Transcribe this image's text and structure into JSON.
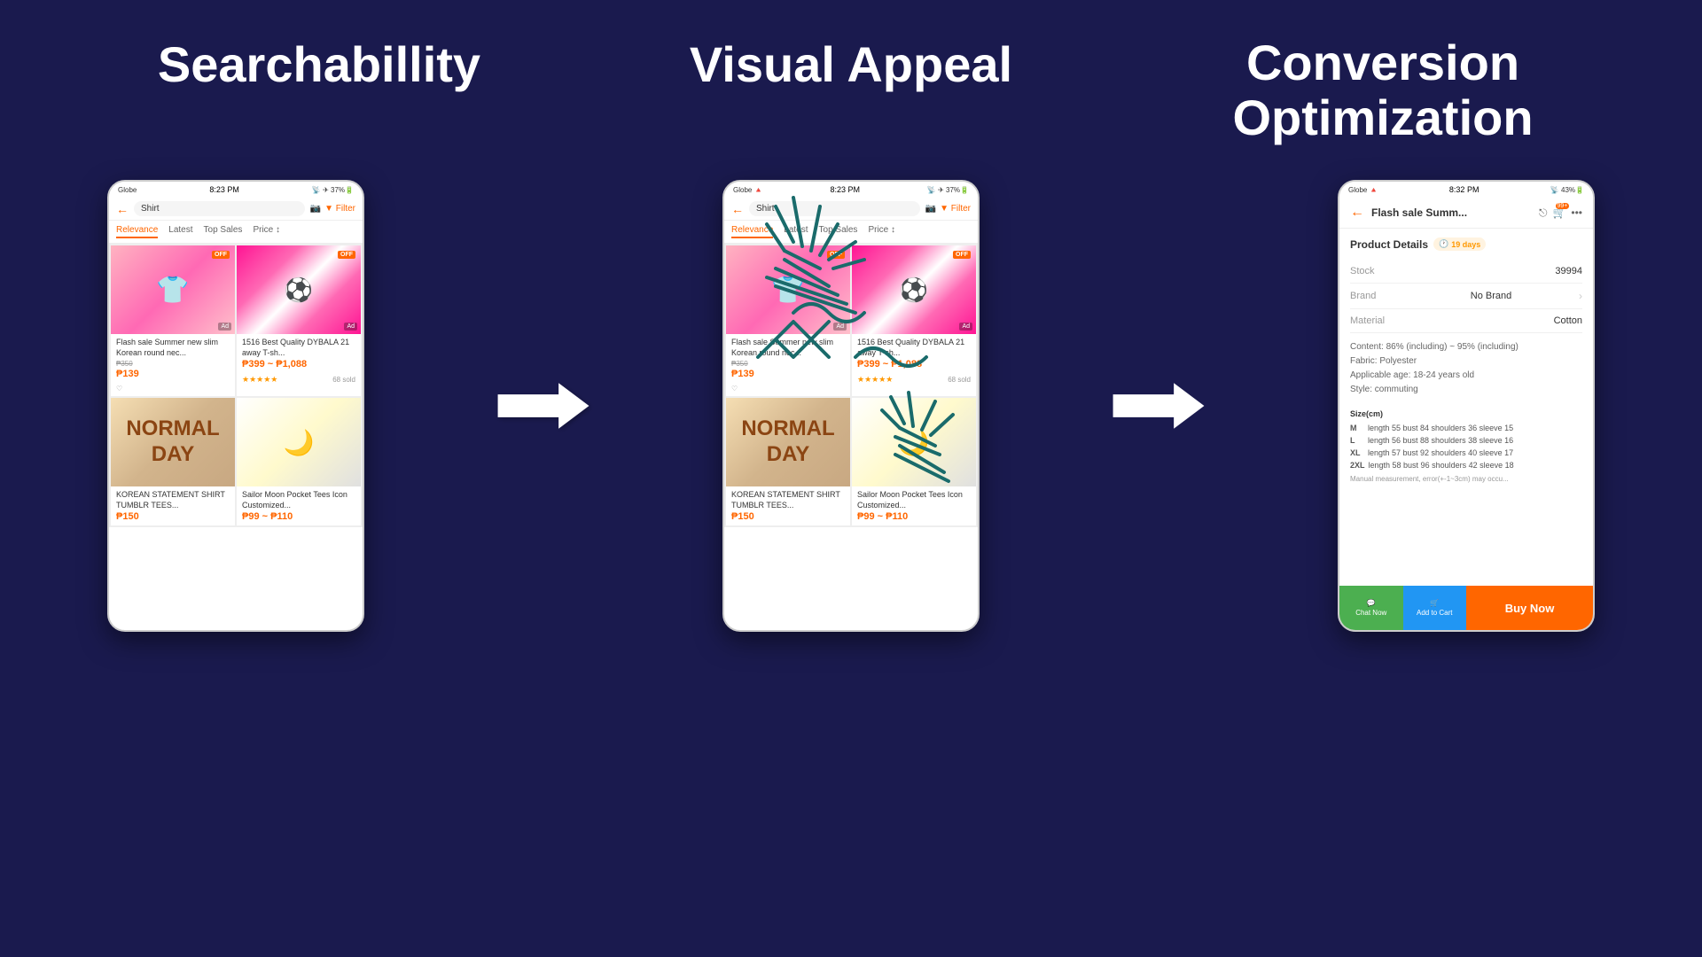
{
  "page": {
    "background": "#1a1a4e",
    "sections": {
      "searchability": {
        "title": "Searchabillity"
      },
      "visual_appeal": {
        "title": "Visual Appeal"
      },
      "conversion": {
        "title": "Conversion\nOptimization"
      }
    }
  },
  "phone1": {
    "status": {
      "carrier": "Globe",
      "time": "8:23 PM",
      "battery": "37%"
    },
    "search": {
      "query": "Shirt",
      "filter_label": "Filter"
    },
    "tabs": [
      "Relevance",
      "Latest",
      "Top Sales",
      "Price"
    ],
    "products": [
      {
        "name": "Flash sale Summer new slim Korean round nec...",
        "original_price": "₱350",
        "sale_price": "₱139",
        "type": "pink-shirt",
        "badge": "OFF",
        "ad": "Ad"
      },
      {
        "name": "1516 Best Quality DYBALA 21 away T-sh...",
        "price_range": "₱399 ~ ₱1,088",
        "stars": "★★★★★",
        "sold": "68 sold",
        "type": "jeep-shirt",
        "badge": "OFF",
        "ad": "Ad"
      },
      {
        "name": "KOREAN STATEMENT SHIRT TUMBLR TEES...",
        "sale_price": "₱150",
        "type": "normal-day-shirt"
      },
      {
        "name": "Sailor Moon Pocket Tees Icon Customized...",
        "price_range": "₱99 ~ ₱110",
        "type": "sailor-moon-shirt"
      }
    ]
  },
  "phone3": {
    "status": {
      "carrier": "Globe",
      "time": "8:32 PM",
      "battery": "43%"
    },
    "header": {
      "title": "Flash sale Summ...",
      "cart_count": "99+"
    },
    "product_details_label": "Product Details",
    "days_badge": "19 days",
    "details": {
      "stock": "39994",
      "brand": "No Brand",
      "material": "Cotton"
    },
    "specs": {
      "content": "Content: 86% (including) ~ 95% (including)",
      "fabric": "Fabric: Polyester",
      "age": "Applicable age: 18-24 years old",
      "style": "Style: commuting"
    },
    "size_label": "Size(cm)",
    "sizes": [
      {
        "size": "M",
        "length": 55,
        "bust": 84,
        "shoulders": 36,
        "sleeve": 15
      },
      {
        "size": "L",
        "length": 56,
        "bust": 88,
        "shoulders": 38,
        "sleeve": 16
      },
      {
        "size": "XL",
        "length": 57,
        "bust": 92,
        "shoulders": 40,
        "sleeve": 17
      },
      {
        "size": "2XL",
        "length": 58,
        "bust": 96,
        "shoulders": 42,
        "sleeve": 18
      }
    ],
    "measurement_note": "Manual measurement, error(+-1~3cm) may occu...",
    "footer": {
      "chat_label": "Chat Now",
      "cart_label": "Add to Cart",
      "buy_label": "Buy Now"
    }
  },
  "arrows": {
    "arrow1_label": "arrow-right-1",
    "arrow2_label": "arrow-right-2"
  }
}
